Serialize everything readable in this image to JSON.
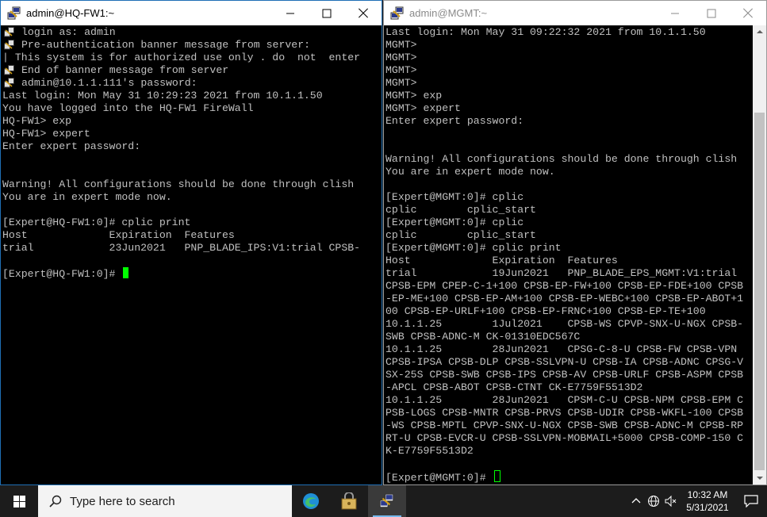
{
  "left_window": {
    "title": "admin@HQ-FW1:~",
    "lines": [
      {
        "icon": true,
        "text": "login as: admin"
      },
      {
        "icon": true,
        "text": "Pre-authentication banner message from server:"
      },
      {
        "icon": false,
        "text": "| This system is for authorized use only . do  not  enter"
      },
      {
        "icon": true,
        "text": "End of banner message from server"
      },
      {
        "icon": true,
        "text": "admin@10.1.1.111's password:"
      },
      {
        "icon": false,
        "text": "Last login: Mon May 31 10:29:23 2021 from 10.1.1.50"
      },
      {
        "icon": false,
        "text": "You have logged into the HQ-FW1 FireWall"
      },
      {
        "icon": false,
        "text": "HQ-FW1> exp"
      },
      {
        "icon": false,
        "text": "HQ-FW1> expert"
      },
      {
        "icon": false,
        "text": "Enter expert password:"
      },
      {
        "icon": false,
        "text": ""
      },
      {
        "icon": false,
        "text": ""
      },
      {
        "icon": false,
        "text": "Warning! All configurations should be done through clish"
      },
      {
        "icon": false,
        "text": "You are in expert mode now."
      },
      {
        "icon": false,
        "text": ""
      },
      {
        "icon": false,
        "text": "[Expert@HQ-FW1:0]# cplic print"
      },
      {
        "icon": false,
        "text": "Host             Expiration  Features"
      },
      {
        "icon": false,
        "text": "trial            23Jun2021   PNP_BLADE_IPS:V1:trial CPSB-"
      },
      {
        "icon": false,
        "text": ""
      }
    ],
    "prompt": "[Expert@HQ-FW1:0]# "
  },
  "right_window": {
    "title": "admin@MGMT:~",
    "lines": [
      "Last login: Mon May 31 09:22:32 2021 from 10.1.1.50",
      "MGMT>",
      "MGMT>",
      "MGMT>",
      "MGMT>",
      "MGMT> exp",
      "MGMT> expert",
      "Enter expert password:",
      "",
      "",
      "Warning! All configurations should be done through clish",
      "You are in expert mode now.",
      "",
      "[Expert@MGMT:0]# cplic",
      "cplic        cplic_start",
      "[Expert@MGMT:0]# cplic",
      "cplic        cplic_start",
      "[Expert@MGMT:0]# cplic print",
      "Host             Expiration  Features",
      "trial            19Jun2021   PNP_BLADE_EPS_MGMT:V1:trial",
      "CPSB-EPM CPEP-C-1+100 CPSB-EP-FW+100 CPSB-EP-FDE+100 CPSB",
      "-EP-ME+100 CPSB-EP-AM+100 CPSB-EP-WEBC+100 CPSB-EP-ABOT+1",
      "00 CPSB-EP-URLF+100 CPSB-EP-FRNC+100 CPSB-EP-TE+100",
      "10.1.1.25        1Jul2021    CPSB-WS CPVP-SNX-U-NGX CPSB-",
      "SWB CPSB-ADNC-M CK-01310EDC567C",
      "10.1.1.25        28Jun2021   CPSG-C-8-U CPSB-FW CPSB-VPN",
      "CPSB-IPSA CPSB-DLP CPSB-SSLVPN-U CPSB-IA CPSB-ADNC CPSG-V",
      "SX-25S CPSB-SWB CPSB-IPS CPSB-AV CPSB-URLF CPSB-ASPM CPSB",
      "-APCL CPSB-ABOT CPSB-CTNT CK-E7759F5513D2",
      "10.1.1.25        28Jun2021   CPSM-C-U CPSB-NPM CPSB-EPM C",
      "PSB-LOGS CPSB-MNTR CPSB-PRVS CPSB-UDIR CPSB-WKFL-100 CPSB",
      "-WS CPSB-MPTL CPVP-SNX-U-NGX CPSB-SWB CPSB-ADNC-M CPSB-RP",
      "RT-U CPSB-EVCR-U CPSB-SSLVPN-MOBMAIL+5000 CPSB-COMP-150 C",
      "K-E7759F5513D2",
      ""
    ],
    "prompt": "[Expert@MGMT:0]# "
  },
  "taskbar": {
    "search_placeholder": "Type here to search",
    "time": "10:32 AM",
    "date": "5/31/2021"
  },
  "colors": {
    "terminal_bg": "#000000",
    "terminal_fg": "#c0c0c0",
    "cursor": "#00ff00",
    "active_border": "#1f6fb5",
    "taskbar_bg": "#1c1c1c"
  }
}
